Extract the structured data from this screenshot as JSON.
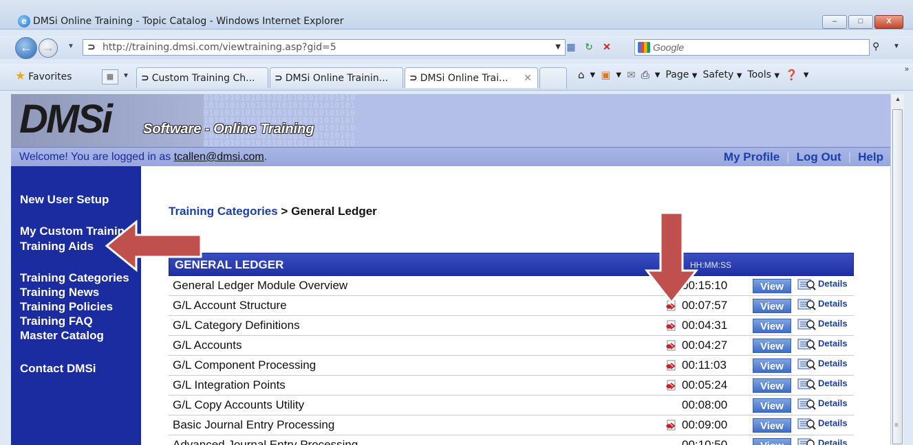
{
  "window": {
    "title": "DMSi Online Training - Topic Catalog - Windows Internet Explorer",
    "min_label": "–",
    "max_label": "□",
    "close_label": "X"
  },
  "address": {
    "url": "http://training.dmsi.com/viewtraining.asp?gid=5",
    "search_placeholder": "Google"
  },
  "tabs": {
    "favorites_label": "Favorites",
    "items": [
      {
        "label": "Custom Training Ch..."
      },
      {
        "label": "DMSi Online Trainin..."
      },
      {
        "label": "DMSi Online Trai..."
      }
    ]
  },
  "commandbar": {
    "page_label": "Page",
    "safety_label": "Safety",
    "tools_label": "Tools"
  },
  "site": {
    "logo_text": "DMSi",
    "tagline": "Software - Online Training",
    "welcome_text": "Welcome! You are logged in as ",
    "user_email": "tcallen@dmsi.com",
    "welcome_end": ".",
    "links": {
      "profile": "My Profile",
      "logout": "Log Out",
      "help": "Help"
    }
  },
  "sidebar": {
    "items": [
      {
        "label": "New User Setup"
      },
      {
        "label": "My Custom Training"
      },
      {
        "label": "Training Aids"
      },
      {
        "label": "Training Categories"
      },
      {
        "label": "Training News"
      },
      {
        "label": "Training Policies"
      },
      {
        "label": "Training FAQ"
      },
      {
        "label": "Master Catalog"
      },
      {
        "label": "Contact DMSi"
      }
    ]
  },
  "main": {
    "crumb_link": "Training Categories",
    "crumb_sep": " > ",
    "crumb_current": "General Ledger",
    "table_title": "GENERAL LEDGER",
    "duration_header": "HH:MM:SS",
    "view_label": "View",
    "details_label": "Details",
    "rows": [
      {
        "name": "General Ledger Module Overview",
        "time": "00:15:10",
        "pdf": false
      },
      {
        "name": "G/L Account Structure",
        "time": "00:07:57",
        "pdf": true
      },
      {
        "name": "G/L Category Definitions",
        "time": "00:04:31",
        "pdf": true
      },
      {
        "name": "G/L Accounts",
        "time": "00:04:27",
        "pdf": true
      },
      {
        "name": "G/L Component Processing",
        "time": "00:11:03",
        "pdf": true
      },
      {
        "name": "G/L Integration Points",
        "time": "00:05:24",
        "pdf": true
      },
      {
        "name": "G/L Copy Accounts Utility",
        "time": "00:08:00",
        "pdf": false
      },
      {
        "name": "Basic Journal Entry Processing",
        "time": "00:09:00",
        "pdf": true
      },
      {
        "name": "Advanced Journal Entry Processing",
        "time": "00:10:50",
        "pdf": false
      }
    ]
  },
  "colors": {
    "sidebar_bg": "#1b2ba0",
    "header_bg": "#b3bfe7",
    "table_header": "#2a3db0",
    "annotation_arrow": "#c0504d"
  }
}
